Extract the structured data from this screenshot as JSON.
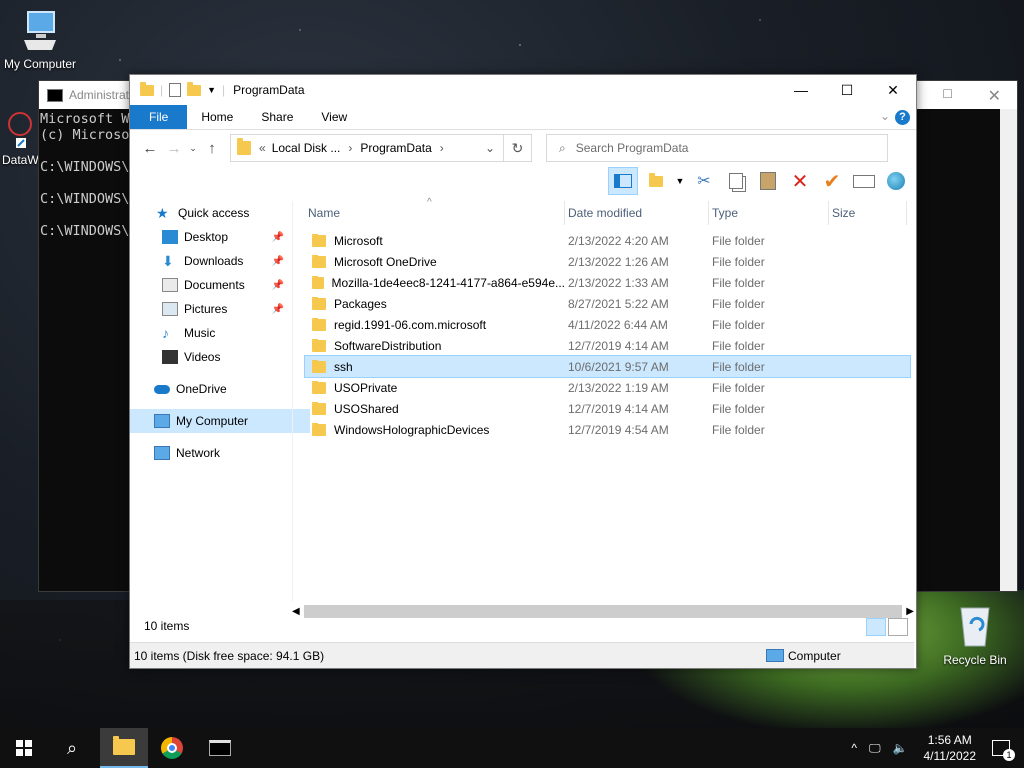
{
  "desktop": {
    "icons": [
      {
        "label": "My Computer",
        "icon": "monitor-icon"
      },
      {
        "label": "DataW",
        "icon": "shortcut-icon"
      },
      {
        "label": "Recycle Bin",
        "icon": "recycle-bin-icon"
      }
    ]
  },
  "console": {
    "title": "Administrat",
    "lines": [
      "Microsoft W",
      "(c) Microso",
      "",
      "C:\\WINDOWS\\s",
      "",
      "C:\\WINDOWS\\s",
      "",
      "C:\\WINDOWS\\s"
    ]
  },
  "explorer": {
    "title": "ProgramData",
    "ribbon_tabs": [
      "File",
      "Home",
      "Share",
      "View"
    ],
    "address": {
      "prefix": "«",
      "crumb1": "Local Disk ...",
      "crumb2": "ProgramData"
    },
    "search_placeholder": "Search ProgramData",
    "nav": {
      "quick_access": "Quick access",
      "desktop": "Desktop",
      "downloads": "Downloads",
      "documents": "Documents",
      "pictures": "Pictures",
      "music": "Music",
      "videos": "Videos",
      "onedrive": "OneDrive",
      "mycomputer": "My Computer",
      "network": "Network"
    },
    "columns": {
      "name": "Name",
      "date": "Date modified",
      "type": "Type",
      "size": "Size"
    },
    "files": [
      {
        "name": "Microsoft",
        "date": "2/13/2022 4:20 AM",
        "type": "File folder"
      },
      {
        "name": "Microsoft OneDrive",
        "date": "2/13/2022 1:26 AM",
        "type": "File folder"
      },
      {
        "name": "Mozilla-1de4eec8-1241-4177-a864-e594e...",
        "date": "2/13/2022 1:33 AM",
        "type": "File folder"
      },
      {
        "name": "Packages",
        "date": "8/27/2021 5:22 AM",
        "type": "File folder"
      },
      {
        "name": "regid.1991-06.com.microsoft",
        "date": "4/11/2022 6:44 AM",
        "type": "File folder"
      },
      {
        "name": "SoftwareDistribution",
        "date": "12/7/2019 4:14 AM",
        "type": "File folder"
      },
      {
        "name": "ssh",
        "date": "10/6/2021 9:57 AM",
        "type": "File folder"
      },
      {
        "name": "USOPrivate",
        "date": "2/13/2022 1:19 AM",
        "type": "File folder"
      },
      {
        "name": "USOShared",
        "date": "12/7/2019 4:14 AM",
        "type": "File folder"
      },
      {
        "name": "WindowsHolographicDevices",
        "date": "12/7/2019 4:54 AM",
        "type": "File folder"
      }
    ],
    "item_count": "10 items",
    "details": "10 items (Disk free space: 94.1 GB)",
    "location": "Computer"
  },
  "taskbar": {
    "time": "1:56 AM",
    "date": "4/11/2022",
    "notifications": "1"
  },
  "colors": {
    "accent": "#1979ca",
    "selection": "#cce8ff"
  }
}
